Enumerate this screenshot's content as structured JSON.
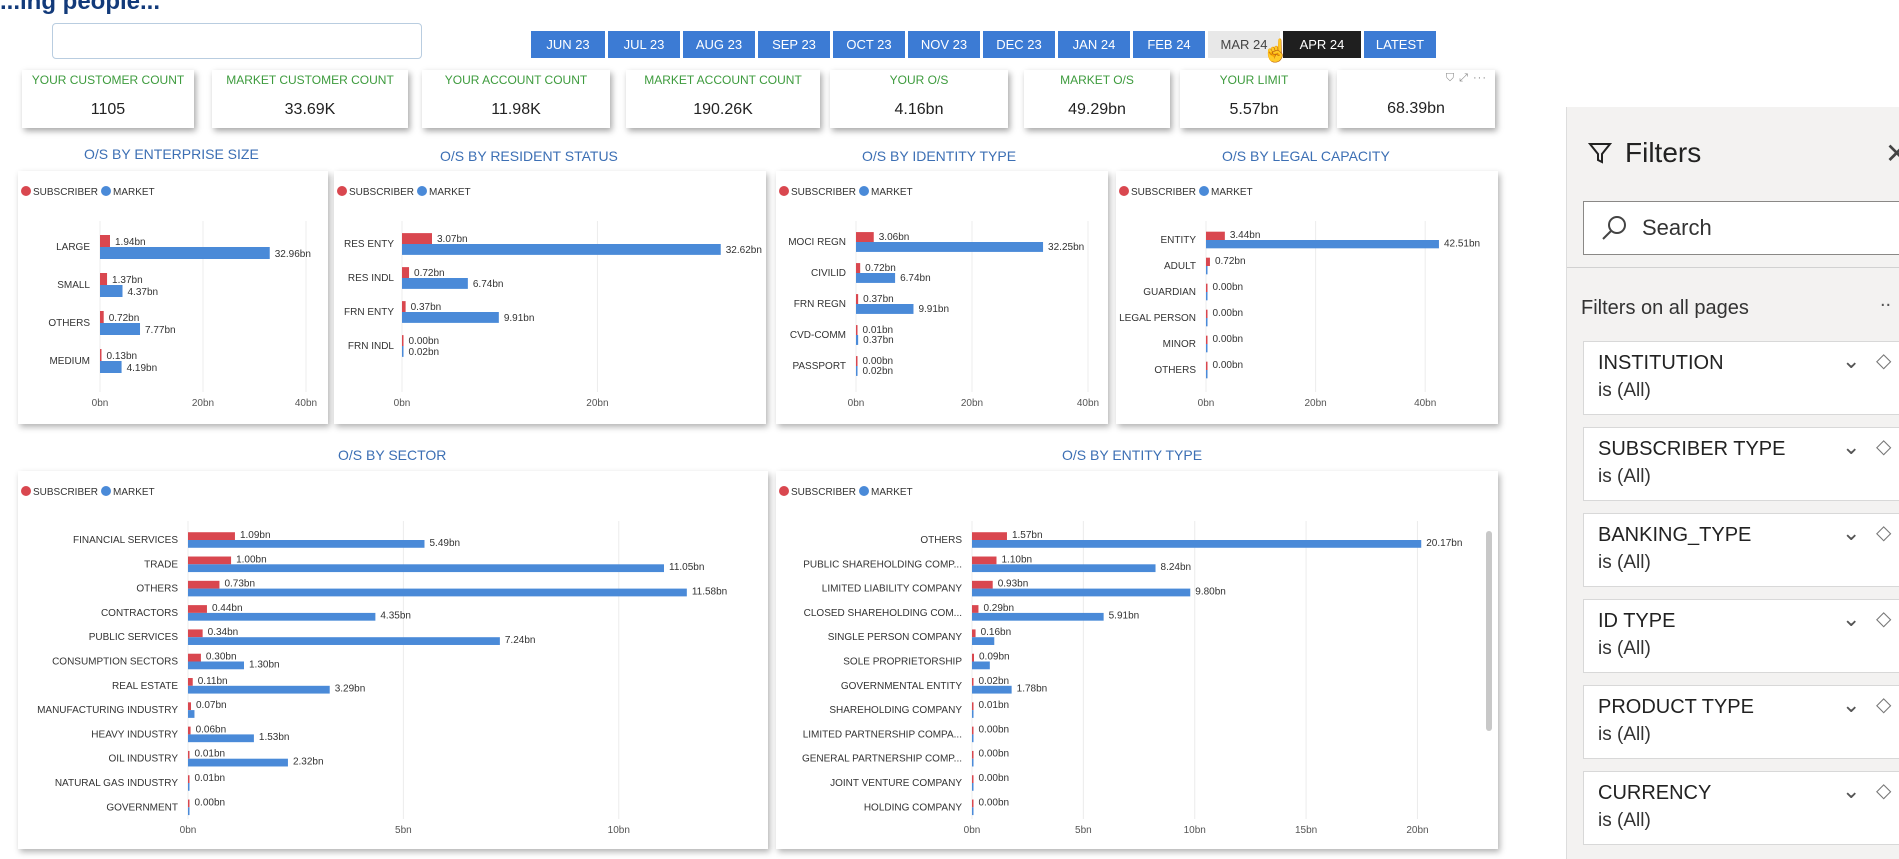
{
  "header": {
    "title_fragment": "...ing people..."
  },
  "months": [
    "JUN 23",
    "JUL 23",
    "AUG 23",
    "SEP 23",
    "OCT 23",
    "NOV 23",
    "DEC 23",
    "JAN 24",
    "FEB 24",
    "MAR 24",
    "APR 24",
    "LATEST"
  ],
  "months_hovered": "MAR 24",
  "months_selected": "APR 24",
  "kpis": [
    {
      "label": "YOUR CUSTOMER COUNT",
      "value": "1105"
    },
    {
      "label": "MARKET CUSTOMER COUNT",
      "value": "33.69K"
    },
    {
      "label": "YOUR ACCOUNT COUNT",
      "value": "11.98K"
    },
    {
      "label": "MARKET ACCOUNT COUNT",
      "value": "190.26K"
    },
    {
      "label": "YOUR O/S",
      "value": "4.16bn"
    },
    {
      "label": "MARKET O/S",
      "value": "49.29bn"
    },
    {
      "label": "YOUR LIMIT",
      "value": "5.57bn"
    },
    {
      "label": "",
      "value": "68.39bn"
    }
  ],
  "legend": {
    "subscriber": "SUBSCRIBER",
    "market": "MARKET"
  },
  "colors": {
    "subscriber": "#d9474f",
    "market": "#4a8ad8",
    "title": "#3c6fb4",
    "kpi_label": "#3d9b3d",
    "month": "#3c7bd4"
  },
  "chart_data": [
    {
      "type": "bar",
      "title": "O/S BY ENTERPRISE SIZE",
      "categories": [
        "LARGE",
        "SMALL",
        "OTHERS",
        "MEDIUM"
      ],
      "series": [
        {
          "name": "SUBSCRIBER",
          "values": [
            1.94,
            1.37,
            0.72,
            0.13
          ],
          "labels": [
            "1.94bn",
            "1.37bn",
            "0.72bn",
            "0.13bn"
          ]
        },
        {
          "name": "MARKET",
          "values": [
            32.96,
            4.37,
            7.77,
            4.19
          ],
          "labels": [
            "32.96bn",
            "4.37bn",
            "7.77bn",
            "4.19bn"
          ]
        }
      ],
      "xlim": [
        0,
        40
      ],
      "ticks": [
        0,
        20,
        40
      ],
      "tick_labels": [
        "0bn",
        "20bn",
        "40bn"
      ]
    },
    {
      "type": "bar",
      "title": "O/S BY RESIDENT STATUS",
      "categories": [
        "RES ENTY",
        "RES INDL",
        "FRN ENTY",
        "FRN INDL"
      ],
      "series": [
        {
          "name": "SUBSCRIBER",
          "values": [
            3.07,
            0.72,
            0.37,
            0.0
          ],
          "labels": [
            "3.07bn",
            "0.72bn",
            "0.37bn",
            "0.00bn"
          ]
        },
        {
          "name": "MARKET",
          "values": [
            32.62,
            6.74,
            9.91,
            0.02
          ],
          "labels": [
            "32.62bn",
            "6.74bn",
            "9.91bn",
            "0.02bn"
          ]
        }
      ],
      "xlim": [
        0,
        35
      ],
      "ticks": [
        0,
        20
      ],
      "tick_labels": [
        "0bn",
        "20bn"
      ]
    },
    {
      "type": "bar",
      "title": "O/S BY IDENTITY TYPE",
      "categories": [
        "MOCI REGN",
        "CIVILID",
        "FRN REGN",
        "CVD-COMM",
        "PASSPORT"
      ],
      "series": [
        {
          "name": "SUBSCRIBER",
          "values": [
            3.06,
            0.72,
            0.37,
            0.01,
            0.0
          ],
          "labels": [
            "3.06bn",
            "0.72bn",
            "0.37bn",
            "0.01bn",
            "0.00bn"
          ]
        },
        {
          "name": "MARKET",
          "values": [
            32.25,
            6.74,
            9.91,
            0.37,
            0.02
          ],
          "labels": [
            "32.25bn",
            "6.74bn",
            "9.91bn",
            "0.37bn",
            "0.02bn"
          ]
        }
      ],
      "xlim": [
        0,
        40
      ],
      "ticks": [
        0,
        20,
        40
      ],
      "tick_labels": [
        "0bn",
        "20bn",
        "40bn"
      ]
    },
    {
      "type": "bar",
      "title": "O/S BY LEGAL CAPACITY",
      "categories": [
        "ENTITY",
        "ADULT",
        "GUARDIAN",
        "LEGAL PERSON",
        "MINOR",
        "OTHERS"
      ],
      "series": [
        {
          "name": "SUBSCRIBER",
          "values": [
            3.44,
            0.72,
            0.0,
            0.0,
            0.0,
            0.0
          ],
          "labels": [
            "3.44bn",
            "0.72bn",
            "0.00bn",
            "0.00bn",
            "0.00bn",
            "0.00bn"
          ]
        },
        {
          "name": "MARKET",
          "values": [
            42.51,
            0,
            0,
            0,
            0,
            0
          ],
          "labels": [
            "42.51bn",
            "",
            "",
            "",
            "",
            ""
          ]
        }
      ],
      "xlim": [
        0,
        50
      ],
      "ticks": [
        0,
        20,
        40
      ],
      "tick_labels": [
        "0bn",
        "20bn",
        "40bn"
      ]
    },
    {
      "type": "bar",
      "title": "O/S BY SECTOR",
      "categories": [
        "FINANCIAL SERVICES",
        "TRADE",
        "OTHERS",
        "CONTRACTORS",
        "PUBLIC SERVICES",
        "CONSUMPTION SECTORS",
        "REAL ESTATE",
        "MANUFACTURING INDUSTRY",
        "HEAVY INDUSTRY",
        "OIL INDUSTRY",
        "NATURAL GAS INDUSTRY",
        "GOVERNMENT"
      ],
      "series": [
        {
          "name": "SUBSCRIBER",
          "values": [
            1.09,
            1.0,
            0.73,
            0.44,
            0.34,
            0.3,
            0.11,
            0.07,
            0.06,
            0.01,
            0.01,
            0.0
          ],
          "labels": [
            "1.09bn",
            "1.00bn",
            "0.73bn",
            "0.44bn",
            "0.34bn",
            "0.30bn",
            "0.11bn",
            "0.07bn",
            "0.06bn",
            "0.01bn",
            "0.01bn",
            "0.00bn"
          ]
        },
        {
          "name": "MARKET",
          "values": [
            5.49,
            11.05,
            11.58,
            4.35,
            7.24,
            1.3,
            3.29,
            0.15,
            1.53,
            2.32,
            0,
            0
          ],
          "labels": [
            "5.49bn",
            "11.05bn",
            "11.58bn",
            "4.35bn",
            "7.24bn",
            "1.30bn",
            "3.29bn",
            "",
            "1.53bn",
            "2.32bn",
            "",
            ""
          ]
        }
      ],
      "xlim": [
        0,
        13
      ],
      "ticks": [
        0,
        5,
        10
      ],
      "tick_labels": [
        "0bn",
        "5bn",
        "10bn"
      ]
    },
    {
      "type": "bar",
      "title": "O/S BY ENTITY TYPE",
      "categories": [
        "OTHERS",
        "PUBLIC SHAREHOLDING COMP...",
        "LIMITED LIABILITY COMPANY",
        "CLOSED SHAREHOLDING COM...",
        "SINGLE PERSON COMPANY",
        "SOLE PROPRIETORSHIP",
        "GOVERNMENTAL ENTITY",
        "SHAREHOLDING COMPANY",
        "LIMITED PARTNERSHIP COMPA...",
        "GENERAL PARTNERSHIP COMP...",
        "JOINT VENTURE COMPANY",
        "HOLDING COMPANY"
      ],
      "series": [
        {
          "name": "SUBSCRIBER",
          "values": [
            1.57,
            1.1,
            0.93,
            0.29,
            0.16,
            0.09,
            0.02,
            0.01,
            0.0,
            0.0,
            0.0,
            0.0
          ],
          "labels": [
            "1.57bn",
            "1.10bn",
            "0.93bn",
            "0.29bn",
            "0.16bn",
            "0.09bn",
            "0.02bn",
            "0.01bn",
            "0.00bn",
            "0.00bn",
            "0.00bn",
            "0.00bn"
          ]
        },
        {
          "name": "MARKET",
          "values": [
            20.17,
            8.24,
            9.8,
            5.91,
            1.0,
            0.8,
            1.78,
            0,
            0,
            0,
            0,
            0
          ],
          "labels": [
            "20.17bn",
            "8.24bn",
            "9.80bn",
            "5.91bn",
            "",
            "",
            "1.78bn",
            "",
            "",
            "",
            "",
            ""
          ]
        }
      ],
      "xlim": [
        0,
        22
      ],
      "ticks": [
        0,
        5,
        10,
        15,
        20
      ],
      "tick_labels": [
        "0bn",
        "5bn",
        "10bn",
        "15bn",
        "20bn"
      ]
    }
  ],
  "filters": {
    "title": "Filters",
    "search_placeholder": "Search",
    "section": "Filters on all pages",
    "more": "..",
    "items": [
      {
        "name": "INSTITUTION",
        "value": "is (All)"
      },
      {
        "name": "SUBSCRIBER TYPE",
        "value": "is (All)"
      },
      {
        "name": "BANKING_TYPE",
        "value": "is (All)"
      },
      {
        "name": "ID TYPE",
        "value": "is (All)"
      },
      {
        "name": "PRODUCT TYPE",
        "value": "is (All)"
      },
      {
        "name": "CURRENCY",
        "value": "is (All)"
      }
    ]
  }
}
